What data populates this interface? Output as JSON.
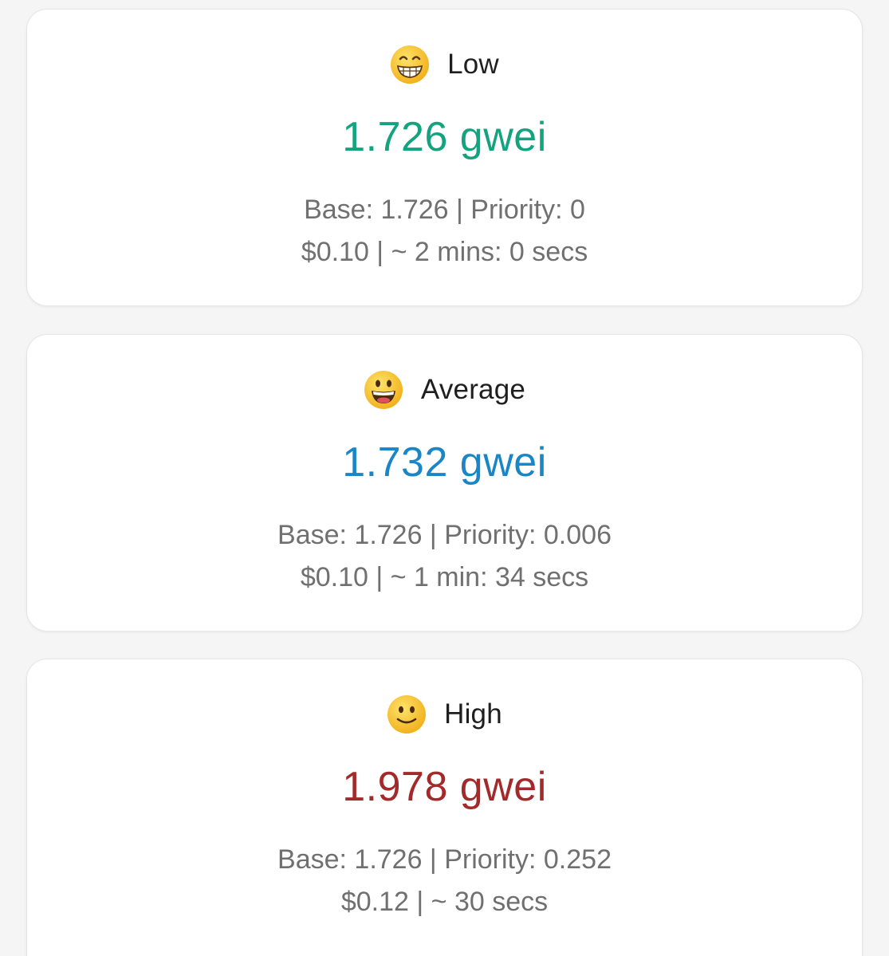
{
  "colors": {
    "low": "#14a37f",
    "average": "#1a86c6",
    "high": "#a32a2a",
    "detail_text": "#707070",
    "label_text": "#1f1f1f",
    "emoji_face": "#f7c62f"
  },
  "tiers": [
    {
      "name": "Low",
      "emoji": "grinning-teeth-face-icon",
      "price": "1.726 gwei",
      "base_priority": "Base: 1.726 | Priority: 0",
      "cost_time": "$0.10 | ~ 2 mins: 0 secs"
    },
    {
      "name": "Average",
      "emoji": "grinning-open-mouth-face-icon",
      "price": "1.732 gwei",
      "base_priority": "Base: 1.726 | Priority: 0.006",
      "cost_time": "$0.10 | ~ 1 min: 34 secs"
    },
    {
      "name": "High",
      "emoji": "slightly-smiling-face-icon",
      "price": "1.978 gwei",
      "base_priority": "Base: 1.726 | Priority: 0.252",
      "cost_time": "$0.12 | ~ 30 secs"
    }
  ]
}
